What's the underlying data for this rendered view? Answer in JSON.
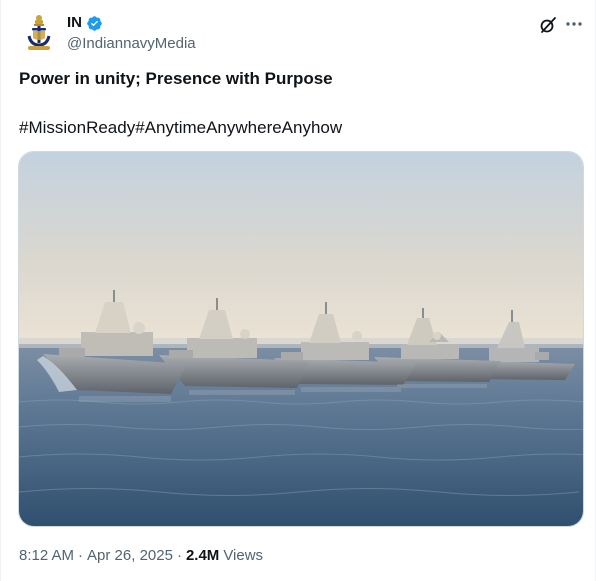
{
  "author": {
    "display_name": "IN",
    "handle": "@IndiannavyMedia",
    "avatar_icon": "indian-navy-crest-icon",
    "verified_icon": "verified-badge-icon",
    "verified_color": "#1d9bf0"
  },
  "actions": {
    "grok_icon": "grok-icon",
    "more_icon": "more-options-icon"
  },
  "tweet": {
    "line1": "Power in unity; Presence with Purpose",
    "line2": "#MissionReady#AnytimeAnywhereAnyhow"
  },
  "media": {
    "subject": "five warships sailing in formation on the sea"
  },
  "meta": {
    "time": "8:12 AM",
    "separator": "·",
    "date": "Apr 26, 2025",
    "views_count": "2.4M",
    "views_label": "Views"
  },
  "colors": {
    "text_primary": "#0f1419",
    "text_secondary": "#536471",
    "border": "#cfd9de"
  }
}
